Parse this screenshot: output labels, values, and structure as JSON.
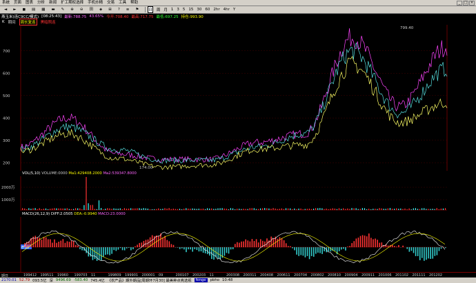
{
  "menu": [
    "系统",
    "页面",
    "图表",
    "分析",
    "新闻",
    "扩工期权选择",
    "手机炒精",
    "交易",
    "工具",
    "帮助"
  ],
  "win_controls": [
    "_",
    "□",
    "×"
  ],
  "toolbar": {
    "buttons": [
      "◄",
      "►",
      "◼",
      "▤",
      "▦",
      "▬",
      "✎",
      "⊕",
      "⊖",
      "田",
      "◈",
      "⊞",
      "?",
      "≡",
      "⚑"
    ],
    "periods": [
      "日",
      "周",
      "月",
      "1",
      "3",
      "5",
      "15",
      "30",
      "60",
      "2hr",
      "4hr",
      "Y"
    ],
    "active_period": "日"
  },
  "title": {
    "name": "燕玉米(连C9CC/模式)",
    "items": [
      "[08:25:43]",
      "最新:788.75",
      "43.65%",
      "今开:708.40",
      "最高:717.75",
      "最低:697.25",
      "持仓:993.90"
    ]
  },
  "subtitle": {
    "items": [
      "K",
      "期间",
      "周长复连",
      "黑暗照连"
    ]
  },
  "price_axis": {
    "labels": [
      "700",
      "600",
      "500",
      "400",
      "300",
      "200"
    ],
    "values": [
      700,
      600,
      500,
      400,
      300,
      200
    ]
  },
  "annotations": {
    "high": "799.40",
    "low": "174.00"
  },
  "volume": {
    "label": "VOL(5,10)",
    "items": [
      "VOLUME:0000",
      "Ma1:429408.2000",
      "Ma2:539347.8000"
    ],
    "axis": [
      "2000万",
      "1000万"
    ]
  },
  "macd": {
    "label": "MACD(26,12,9)",
    "items": [
      "DIFF:2.0505",
      "DEA:-0.9940",
      "MACD:23.0000"
    ],
    "zero_label": "0.00"
  },
  "xaxis": {
    "label": "期日",
    "ticks": [
      "199412",
      "199511",
      "19960",
      "199703",
      "11",
      "199809",
      "199901",
      "200001",
      "09",
      "200107",
      "200203",
      "11",
      "200308",
      "200311",
      "200408",
      "200611",
      "200704",
      "200802",
      "200810",
      "200904",
      "200911",
      "201006",
      "201102",
      "201111",
      "201202"
    ]
  },
  "status": {
    "items": [
      "2170.01",
      "52.79",
      "093.5亿",
      "深",
      "9496.69",
      "-583.40",
      "745.4亿",
      "《农产品》期外期品[周期环7月30] 最美种点亮选视",
      "fenge",
      "pbho",
      "10:48"
    ]
  },
  "chart_data": {
    "type": "line",
    "title": "燕玉米(连C9CC/模式)",
    "xlabel": "",
    "ylabel": "",
    "ylim": [
      170,
      810
    ],
    "x": [
      "1994",
      "1996",
      "1998",
      "2000",
      "2002",
      "2004",
      "2006",
      "2008",
      "2010",
      "2012"
    ],
    "series": [
      {
        "name": "",
        "values": [
          270,
          400,
          240,
          215,
          215,
          290,
          330,
          760,
          450,
          720
        ]
      },
      {
        "name": "",
        "values": [
          260,
          360,
          260,
          210,
          210,
          270,
          330,
          700,
          420,
          620
        ]
      },
      {
        "name": "",
        "values": [
          250,
          330,
          220,
          180,
          190,
          260,
          280,
          640,
          380,
          470
        ]
      }
    ]
  }
}
